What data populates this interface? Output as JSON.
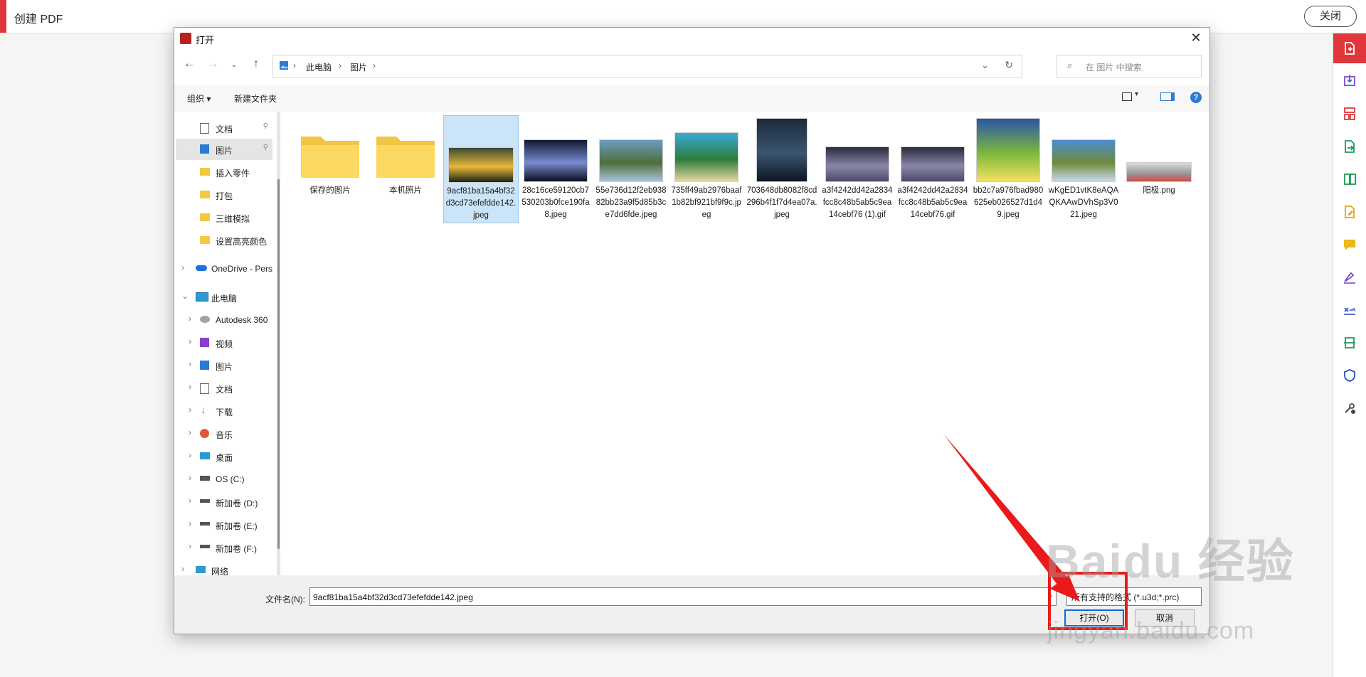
{
  "app": {
    "title": "创建 PDF",
    "close_label": "关闭",
    "accent_color": "#e0373c"
  },
  "dialog": {
    "title": "打开",
    "breadcrumb": [
      "此电脑",
      "图片"
    ],
    "search_placeholder": "在 图片 中搜索",
    "toolbar": {
      "organize": "组织 ▾",
      "new_folder": "新建文件夹"
    },
    "sidebar": [
      {
        "label": "文档",
        "icon": "document-icon",
        "pinned": true
      },
      {
        "label": "图片",
        "icon": "pictures-icon",
        "pinned": true,
        "selected": true
      },
      {
        "label": "插入零件",
        "icon": "folder-icon"
      },
      {
        "label": "打包",
        "icon": "folder-icon"
      },
      {
        "label": "三维模拟",
        "icon": "folder-icon"
      },
      {
        "label": "设置高亮颜色",
        "icon": "folder-icon"
      },
      {
        "label": "OneDrive - Pers",
        "icon": "onedrive-icon",
        "expander": "›"
      },
      {
        "label": "此电脑",
        "icon": "computer-icon",
        "expander": "⌄"
      },
      {
        "label": "Autodesk 360",
        "icon": "autodesk-icon",
        "expander": "›"
      },
      {
        "label": "视频",
        "icon": "video-icon",
        "expander": "›"
      },
      {
        "label": "图片",
        "icon": "pictures-icon",
        "expander": "›"
      },
      {
        "label": "文档",
        "icon": "document-icon",
        "expander": "›"
      },
      {
        "label": "下载",
        "icon": "download-icon",
        "expander": "›"
      },
      {
        "label": "音乐",
        "icon": "music-icon",
        "expander": "›"
      },
      {
        "label": "桌面",
        "icon": "desktop-icon",
        "expander": "›"
      },
      {
        "label": "OS (C:)",
        "icon": "drive-c-icon",
        "expander": "›"
      },
      {
        "label": "新加卷 (D:)",
        "icon": "drive-icon",
        "expander": "›"
      },
      {
        "label": "新加卷 (E:)",
        "icon": "drive-icon",
        "expander": "›"
      },
      {
        "label": "新加卷 (F:)",
        "icon": "drive-icon",
        "expander": "›"
      },
      {
        "label": "网络",
        "icon": "network-icon",
        "expander": "›"
      }
    ],
    "files": [
      {
        "name": "保存的图片",
        "kind": "folder"
      },
      {
        "name": "本机照片",
        "kind": "folder"
      },
      {
        "name": "9acf81ba15a4bf32d3cd73efefdde142.jpeg",
        "kind": "image",
        "selected": true,
        "palette": [
          "#3b4a33",
          "#e8b83a",
          "#1c2418"
        ]
      },
      {
        "name": "28c16ce59120cb7530203b0fce190fa8.jpeg",
        "kind": "image",
        "palette": [
          "#101830",
          "#7a8bd0",
          "#0a0f1e"
        ]
      },
      {
        "name": "55e736d12f2eb93882bb23a9f5d85b3ce7dd6fde.jpeg",
        "kind": "image",
        "palette": [
          "#6e9cc2",
          "#4e6e3a",
          "#a9c3d8"
        ]
      },
      {
        "name": "735ff49ab2976baaf1b82bf921bf9f9c.jpeg",
        "kind": "image",
        "palette": [
          "#3aa9d8",
          "#2c7d3a",
          "#e6d7a4"
        ]
      },
      {
        "name": "703648db8082f8cd296b4f1f7d4ea07a.jpeg",
        "kind": "image",
        "palette": [
          "#1c2a3a",
          "#3a5570",
          "#0e1620"
        ]
      },
      {
        "name": "a3f4242dd42a2834fcc8c48b5ab5c9ea14cebf76 (1).gif",
        "kind": "image",
        "palette": [
          "#2a2b3c",
          "#8a86a8",
          "#4a4a6a"
        ]
      },
      {
        "name": "a3f4242dd42a2834fcc8c48b5ab5c9ea14cebf76.gif",
        "kind": "image",
        "palette": [
          "#2a2b3c",
          "#8a86a8",
          "#4a4a6a"
        ]
      },
      {
        "name": "bb2c7a976fbad980625eb026527d1d49.jpeg",
        "kind": "image",
        "palette": [
          "#2a55a8",
          "#7cb83a",
          "#f4e060"
        ]
      },
      {
        "name": "wKgED1vtK8eAQAQKAAwDVhSp3V021.jpeg",
        "kind": "image",
        "palette": [
          "#4c8ed0",
          "#6e8a3c",
          "#c9d9e8"
        ]
      },
      {
        "name": "阳极.png",
        "kind": "image",
        "palette": [
          "#dddddd",
          "#9a9a9a",
          "#d24a4a"
        ]
      }
    ],
    "filename_label": "文件名(N):",
    "filename_value": "9acf81ba15a4bf32d3cd73efefdde142.jpeg",
    "filetype_value": "所有支持的格式 (*.u3d;*.prc)",
    "open_label": "打开(O)",
    "cancel_label": "取消"
  },
  "watermark": {
    "brand": "Baidu 经验",
    "url": "jingyan.baidu.com"
  }
}
